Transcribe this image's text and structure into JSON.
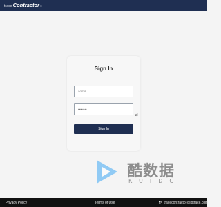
{
  "header": {
    "logo_prefix": "trace",
    "logo_main": "Contractor",
    "logo_mark": "®"
  },
  "login": {
    "title": "Sign In",
    "username_value": "admin",
    "password_value": "••••••••",
    "signin_label": "Sign In"
  },
  "watermark": {
    "main": "酷数据",
    "sub": "KUIDC"
  },
  "footer": {
    "privacy": "Privacy Policy",
    "terms": "Terms of Use",
    "email": "tracecontractor@lbtrace.com"
  },
  "colors": {
    "navbar": "#1f2f52",
    "button": "#1f2f52",
    "footer": "#111111",
    "background": "#f4f4f4",
    "watermark_blue": "#3fa9f5"
  },
  "icons": {
    "password_toggle": "eye-icon",
    "email": "mail-icon",
    "watermark_logo": "play-icon"
  }
}
